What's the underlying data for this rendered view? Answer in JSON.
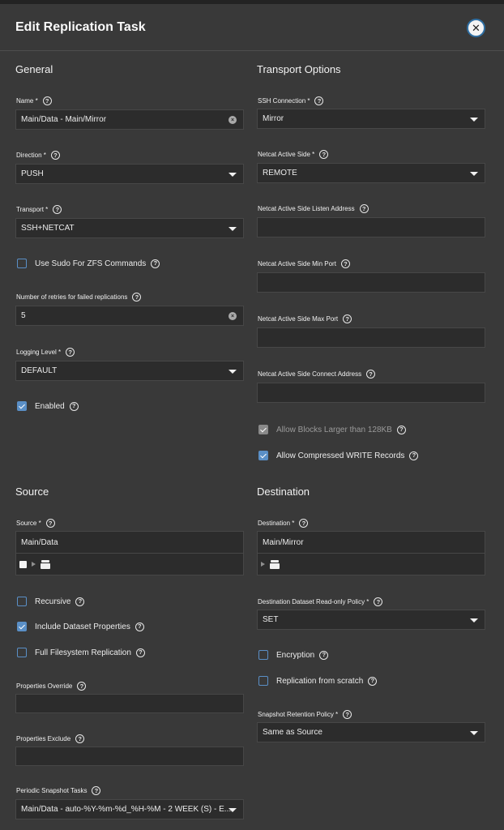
{
  "dialog": {
    "title": "Edit Replication Task",
    "close_icon": "close-icon"
  },
  "general": {
    "title": "General",
    "name": {
      "label": "Name *",
      "value": "Main/Data - Main/Mirror"
    },
    "direction": {
      "label": "Direction *",
      "value": "PUSH"
    },
    "transport": {
      "label": "Transport *",
      "value": "SSH+NETCAT"
    },
    "use_sudo": {
      "label": "Use Sudo For ZFS Commands",
      "checked": false
    },
    "retries": {
      "label": "Number of retries for failed replications",
      "value": "5"
    },
    "logging": {
      "label": "Logging Level *",
      "value": "DEFAULT"
    },
    "enabled": {
      "label": "Enabled",
      "checked": true
    }
  },
  "transport_options": {
    "title": "Transport Options",
    "ssh_connection": {
      "label": "SSH Connection *",
      "value": "Mirror"
    },
    "netcat_active_side": {
      "label": "Netcat Active Side *",
      "value": "REMOTE"
    },
    "listen_address": {
      "label": "Netcat Active Side Listen Address",
      "value": ""
    },
    "min_port": {
      "label": "Netcat Active Side Min Port",
      "value": ""
    },
    "max_port": {
      "label": "Netcat Active Side Max Port",
      "value": ""
    },
    "connect_address": {
      "label": "Netcat Active Side Connect Address",
      "value": ""
    },
    "large_blocks": {
      "label": "Allow Blocks Larger than 128KB",
      "checked": true,
      "disabled": true
    },
    "compressed": {
      "label": "Allow Compressed WRITE Records",
      "checked": true
    }
  },
  "source": {
    "title": "Source",
    "source": {
      "label": "Source *",
      "value": "Main/Data"
    },
    "recursive": {
      "label": "Recursive",
      "checked": false
    },
    "include_props": {
      "label": "Include Dataset Properties",
      "checked": true
    },
    "full_fs": {
      "label": "Full Filesystem Replication",
      "checked": false
    },
    "props_override": {
      "label": "Properties Override",
      "value": ""
    },
    "props_exclude": {
      "label": "Properties Exclude",
      "value": ""
    },
    "periodic_tasks": {
      "label": "Periodic Snapshot Tasks",
      "value": "Main/Data - auto-%Y-%m-%d_%H-%M - 2 WEEK (S) - E..."
    }
  },
  "destination": {
    "title": "Destination",
    "destination": {
      "label": "Destination *",
      "value": "Main/Mirror"
    },
    "readonly_policy": {
      "label": "Destination Dataset Read-only Policy *",
      "value": "SET"
    },
    "encryption": {
      "label": "Encryption",
      "checked": false
    },
    "from_scratch": {
      "label": "Replication from scratch",
      "checked": false
    },
    "retention": {
      "label": "Snapshot Retention Policy *",
      "value": "Same as Source"
    }
  },
  "help_glyph": "?",
  "close_glyph": "✕",
  "clear_glyph": "×"
}
